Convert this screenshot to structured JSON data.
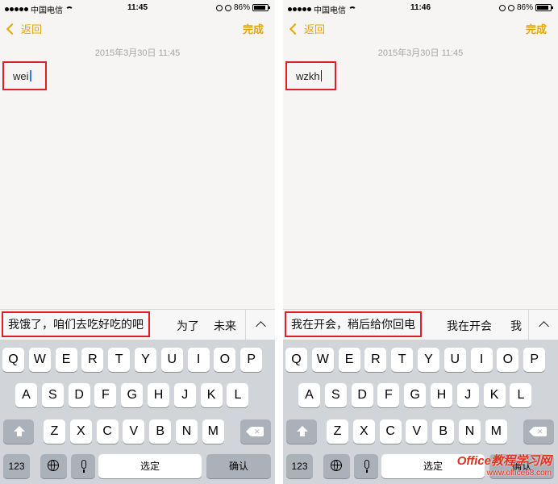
{
  "screens": [
    {
      "status": {
        "carrier": "中国电信",
        "time": "11:45",
        "battery": "86%",
        "battery_level": 0.86
      },
      "nav": {
        "back_label": "返回",
        "done_label": "完成"
      },
      "note": {
        "date": "2015年3月30日 11:45",
        "typed_text": "wei"
      },
      "candidates": {
        "main": "我饿了，咱们去吃好吃的吧",
        "others": [
          "为了",
          "未来"
        ]
      }
    },
    {
      "status": {
        "carrier": "中国电信",
        "time": "11:46",
        "battery": "86%",
        "battery_level": 0.86
      },
      "nav": {
        "back_label": "返回",
        "done_label": "完成"
      },
      "note": {
        "date": "2015年3月30日 11:45",
        "typed_text": "wzkh"
      },
      "candidates": {
        "main": "我在开会，稍后给你回电",
        "others": [
          "我在开会",
          "我"
        ]
      }
    }
  ],
  "keyboard": {
    "row1": [
      "Q",
      "W",
      "E",
      "R",
      "T",
      "Y",
      "U",
      "I",
      "O",
      "P"
    ],
    "row2": [
      "A",
      "S",
      "D",
      "F",
      "G",
      "H",
      "J",
      "K",
      "L"
    ],
    "row3": [
      "Z",
      "X",
      "C",
      "V",
      "B",
      "N",
      "M"
    ],
    "num_label": "123",
    "space_label": "选定",
    "return_label": "确认"
  },
  "watermark": {
    "brand": "Office教程学习网",
    "url": "www.office68.com"
  },
  "colors": {
    "accent": "#e3a700",
    "highlight_border": "#e02028",
    "caret": "#3478f6"
  },
  "icons": [
    "chevron-left-icon",
    "signal-dots-icon",
    "wifi-icon",
    "lock-rotation-icon",
    "alarm-icon",
    "battery-icon",
    "chevron-up-icon",
    "shift-icon",
    "delete-icon",
    "globe-icon",
    "microphone-icon"
  ]
}
